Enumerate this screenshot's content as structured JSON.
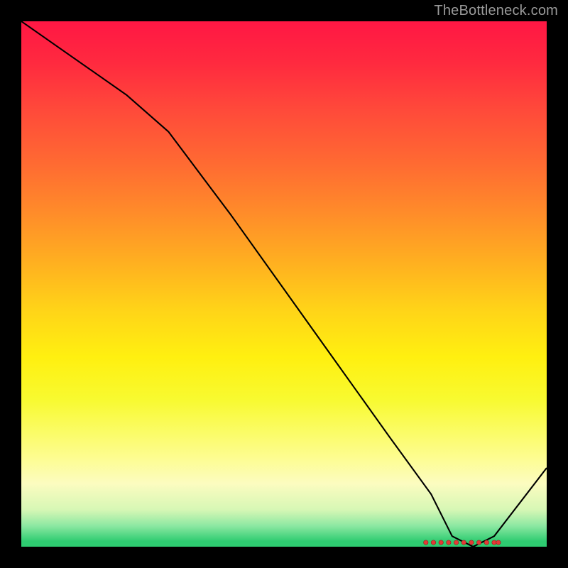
{
  "watermark": "TheBottleneck.com",
  "chart_data": {
    "type": "line",
    "title": "",
    "xlabel": "",
    "ylabel": "",
    "xlim": [
      0,
      100
    ],
    "ylim": [
      0,
      100
    ],
    "x": [
      0,
      10,
      20,
      28,
      40,
      50,
      60,
      70,
      78,
      82,
      86,
      90,
      100
    ],
    "values": [
      100,
      93,
      86,
      79,
      63,
      49,
      35,
      21,
      10,
      2,
      0,
      2,
      15
    ],
    "grid": false,
    "annotations": [
      {
        "type": "marker_cluster",
        "label": "",
        "x_range": [
          77,
          90
        ],
        "y": 0.8
      }
    ]
  },
  "colors": {
    "line": "#000000",
    "marker_fill": "#e53935",
    "marker_stroke": "#8b1e1e",
    "frame": "#000000",
    "watermark": "#9a9a9a"
  }
}
